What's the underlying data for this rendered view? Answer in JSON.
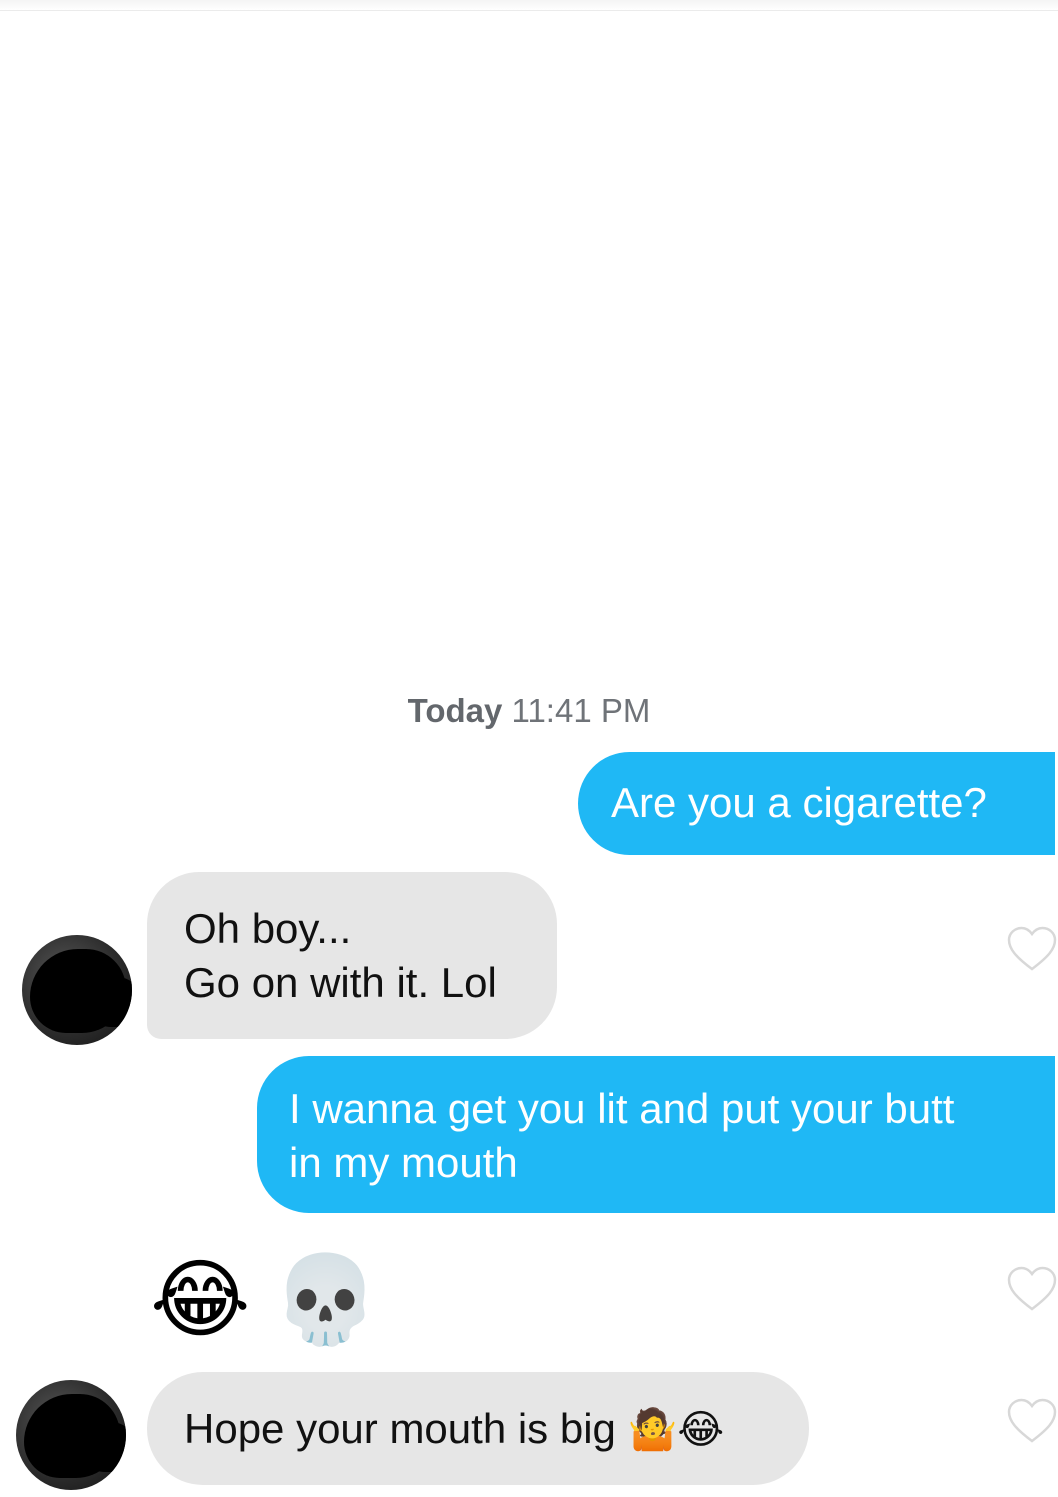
{
  "timestamp": {
    "day": "Today",
    "time": "11:41 PM"
  },
  "messages": [
    {
      "from": "me",
      "lines": [
        "Are you a cigarette?"
      ]
    },
    {
      "from": "them",
      "lines": [
        "Oh boy...",
        "Go on with it. Lol"
      ]
    },
    {
      "from": "me",
      "lines": [
        "I wanna get you lit and put your butt",
        "in my mouth"
      ]
    },
    {
      "from": "them",
      "emoji": [
        "😂",
        "💀"
      ]
    },
    {
      "from": "them",
      "text": "Hope your mouth is big",
      "emoji": [
        "🤷",
        "😂"
      ]
    }
  ],
  "colors": {
    "sent": "#1fb8f5",
    "received": "#e6e6e6",
    "heart": "#d8d8d8"
  },
  "icons": {
    "like": "heart-outline-icon",
    "avatar": "avatar-redacted"
  }
}
